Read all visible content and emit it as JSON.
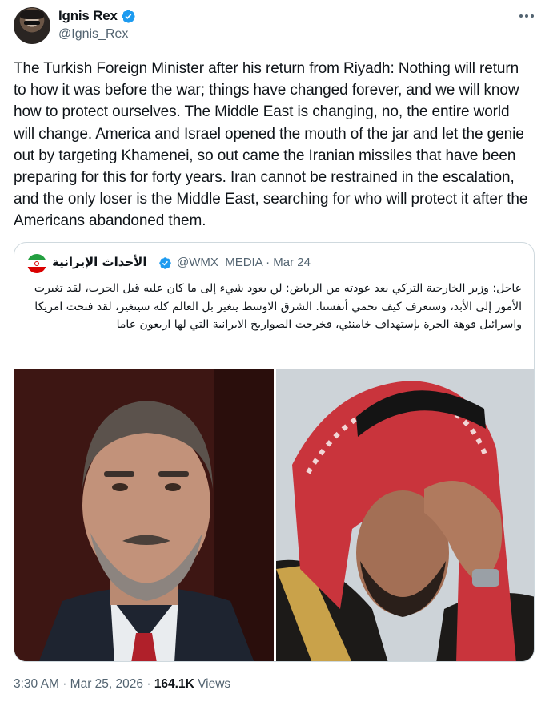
{
  "author": {
    "name": "Ignis Rex",
    "handle": "@Ignis_Rex",
    "verified": true
  },
  "tweet_text": "The Turkish Foreign Minister after his return from Riyadh: Nothing will return to how it was before the war; things have changed forever, and we will know how to protect ourselves. The Middle East is changing, no, the entire world will change. America and Israel opened the mouth of the jar and let the genie out by targeting Khamenei, so out came the Iranian missiles that have been preparing for this for forty years. Iran cannot be restrained in the escalation, and the only loser is the Middle East, searching for who will protect it after the Americans abandoned them.",
  "quoted": {
    "name": "الأحداث الإيرانية",
    "handle": "@WMX_MEDIA",
    "separator": "·",
    "date": "Mar 24",
    "text": "عاجل: وزير الخارجية التركي بعد عودته من الرياض: لن يعود شيء إلى ما كان عليه قبل الحرب، لقد تغيرت الأمور إلى الأبد، وسنعرف كيف نحمي أنفسنا. الشرق الاوسط يتغير بل العالم كله سيتغير، لقد فتحت امريكا واسرائيل فوهة الجرة بإستهداف خامنئي، فخرجت الصواريخ الايرانية التي لها اربعون عاما"
  },
  "footer": {
    "time": "3:30 AM",
    "separator": "·",
    "date": "Mar 25, 2026",
    "views_count": "164.1K",
    "views_label": "Views"
  },
  "colors": {
    "verified_blue": "#1d9bf0",
    "secondary_text": "#536471",
    "border": "#cfd9de"
  }
}
